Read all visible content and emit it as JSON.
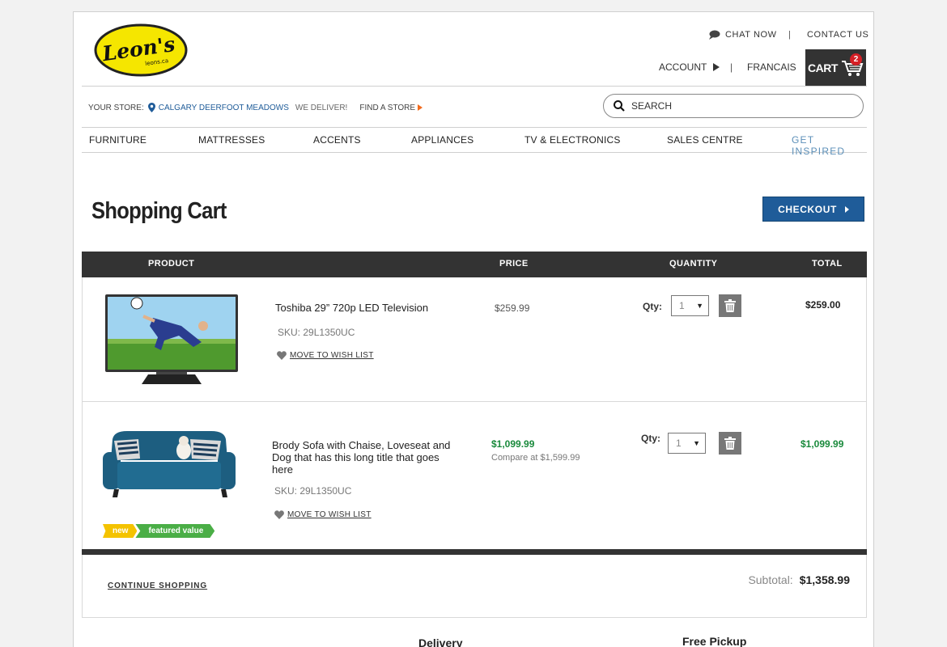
{
  "header": {
    "logo_text": "Leon's",
    "logo_sub": "leons.ca",
    "chat_now": "CHAT NOW",
    "separator": "|",
    "contact_us": "CONTACT US",
    "account": "ACCOUNT",
    "francais": "FRANCAIS",
    "cart_label": "CART",
    "cart_count": "2"
  },
  "store": {
    "label": "YOUR STORE:",
    "name": "CALGARY DEERFOOT MEADOWS",
    "deliver": "WE DELIVER!",
    "find": "FIND A STORE"
  },
  "search": {
    "placeholder": "SEARCH"
  },
  "nav": {
    "items": [
      "FURNITURE",
      "MATTRESSES",
      "ACCENTS",
      "APPLIANCES",
      "TV & ELECTRONICS",
      "SALES CENTRE"
    ],
    "inspired": "GET INSPIRED"
  },
  "page": {
    "title": "Shopping Cart",
    "checkout": "CHECKOUT"
  },
  "table": {
    "headers": {
      "product": "PRODUCT",
      "price": "PRICE",
      "quantity": "QUANTITY",
      "total": "TOTAL"
    },
    "rows": [
      {
        "name": "Toshiba 29” 720p LED Television",
        "sku": "SKU:  29L1350UC",
        "wish": "MOVE TO WISH LIST",
        "price": "$259.99",
        "qty_label": "Qty:",
        "qty": "1",
        "total": "$259.00"
      },
      {
        "name": "Brody Sofa with Chaise, Loveseat and Dog that has this long title that goes here",
        "sku": "SKU:  29L1350UC",
        "wish": "MOVE TO WISH LIST",
        "price": "$1,099.99",
        "compare": "Compare at $1,599.99",
        "qty_label": "Qty:",
        "qty": "1",
        "total": "$1,099.99",
        "badge_new": "new",
        "badge_featured": "featured value"
      }
    ]
  },
  "footer": {
    "continue": "CONTINUE SHOPPING",
    "subtotal_label": "Subtotal:",
    "subtotal_value": "$1,358.99"
  },
  "below": {
    "delivery": "Delivery",
    "pickup": "Free Pickup"
  },
  "colors": {
    "brand_blue": "#1f5c99",
    "sale_green": "#1a8a3c",
    "dark_bar": "#333333",
    "logo_yellow": "#f5e600"
  }
}
